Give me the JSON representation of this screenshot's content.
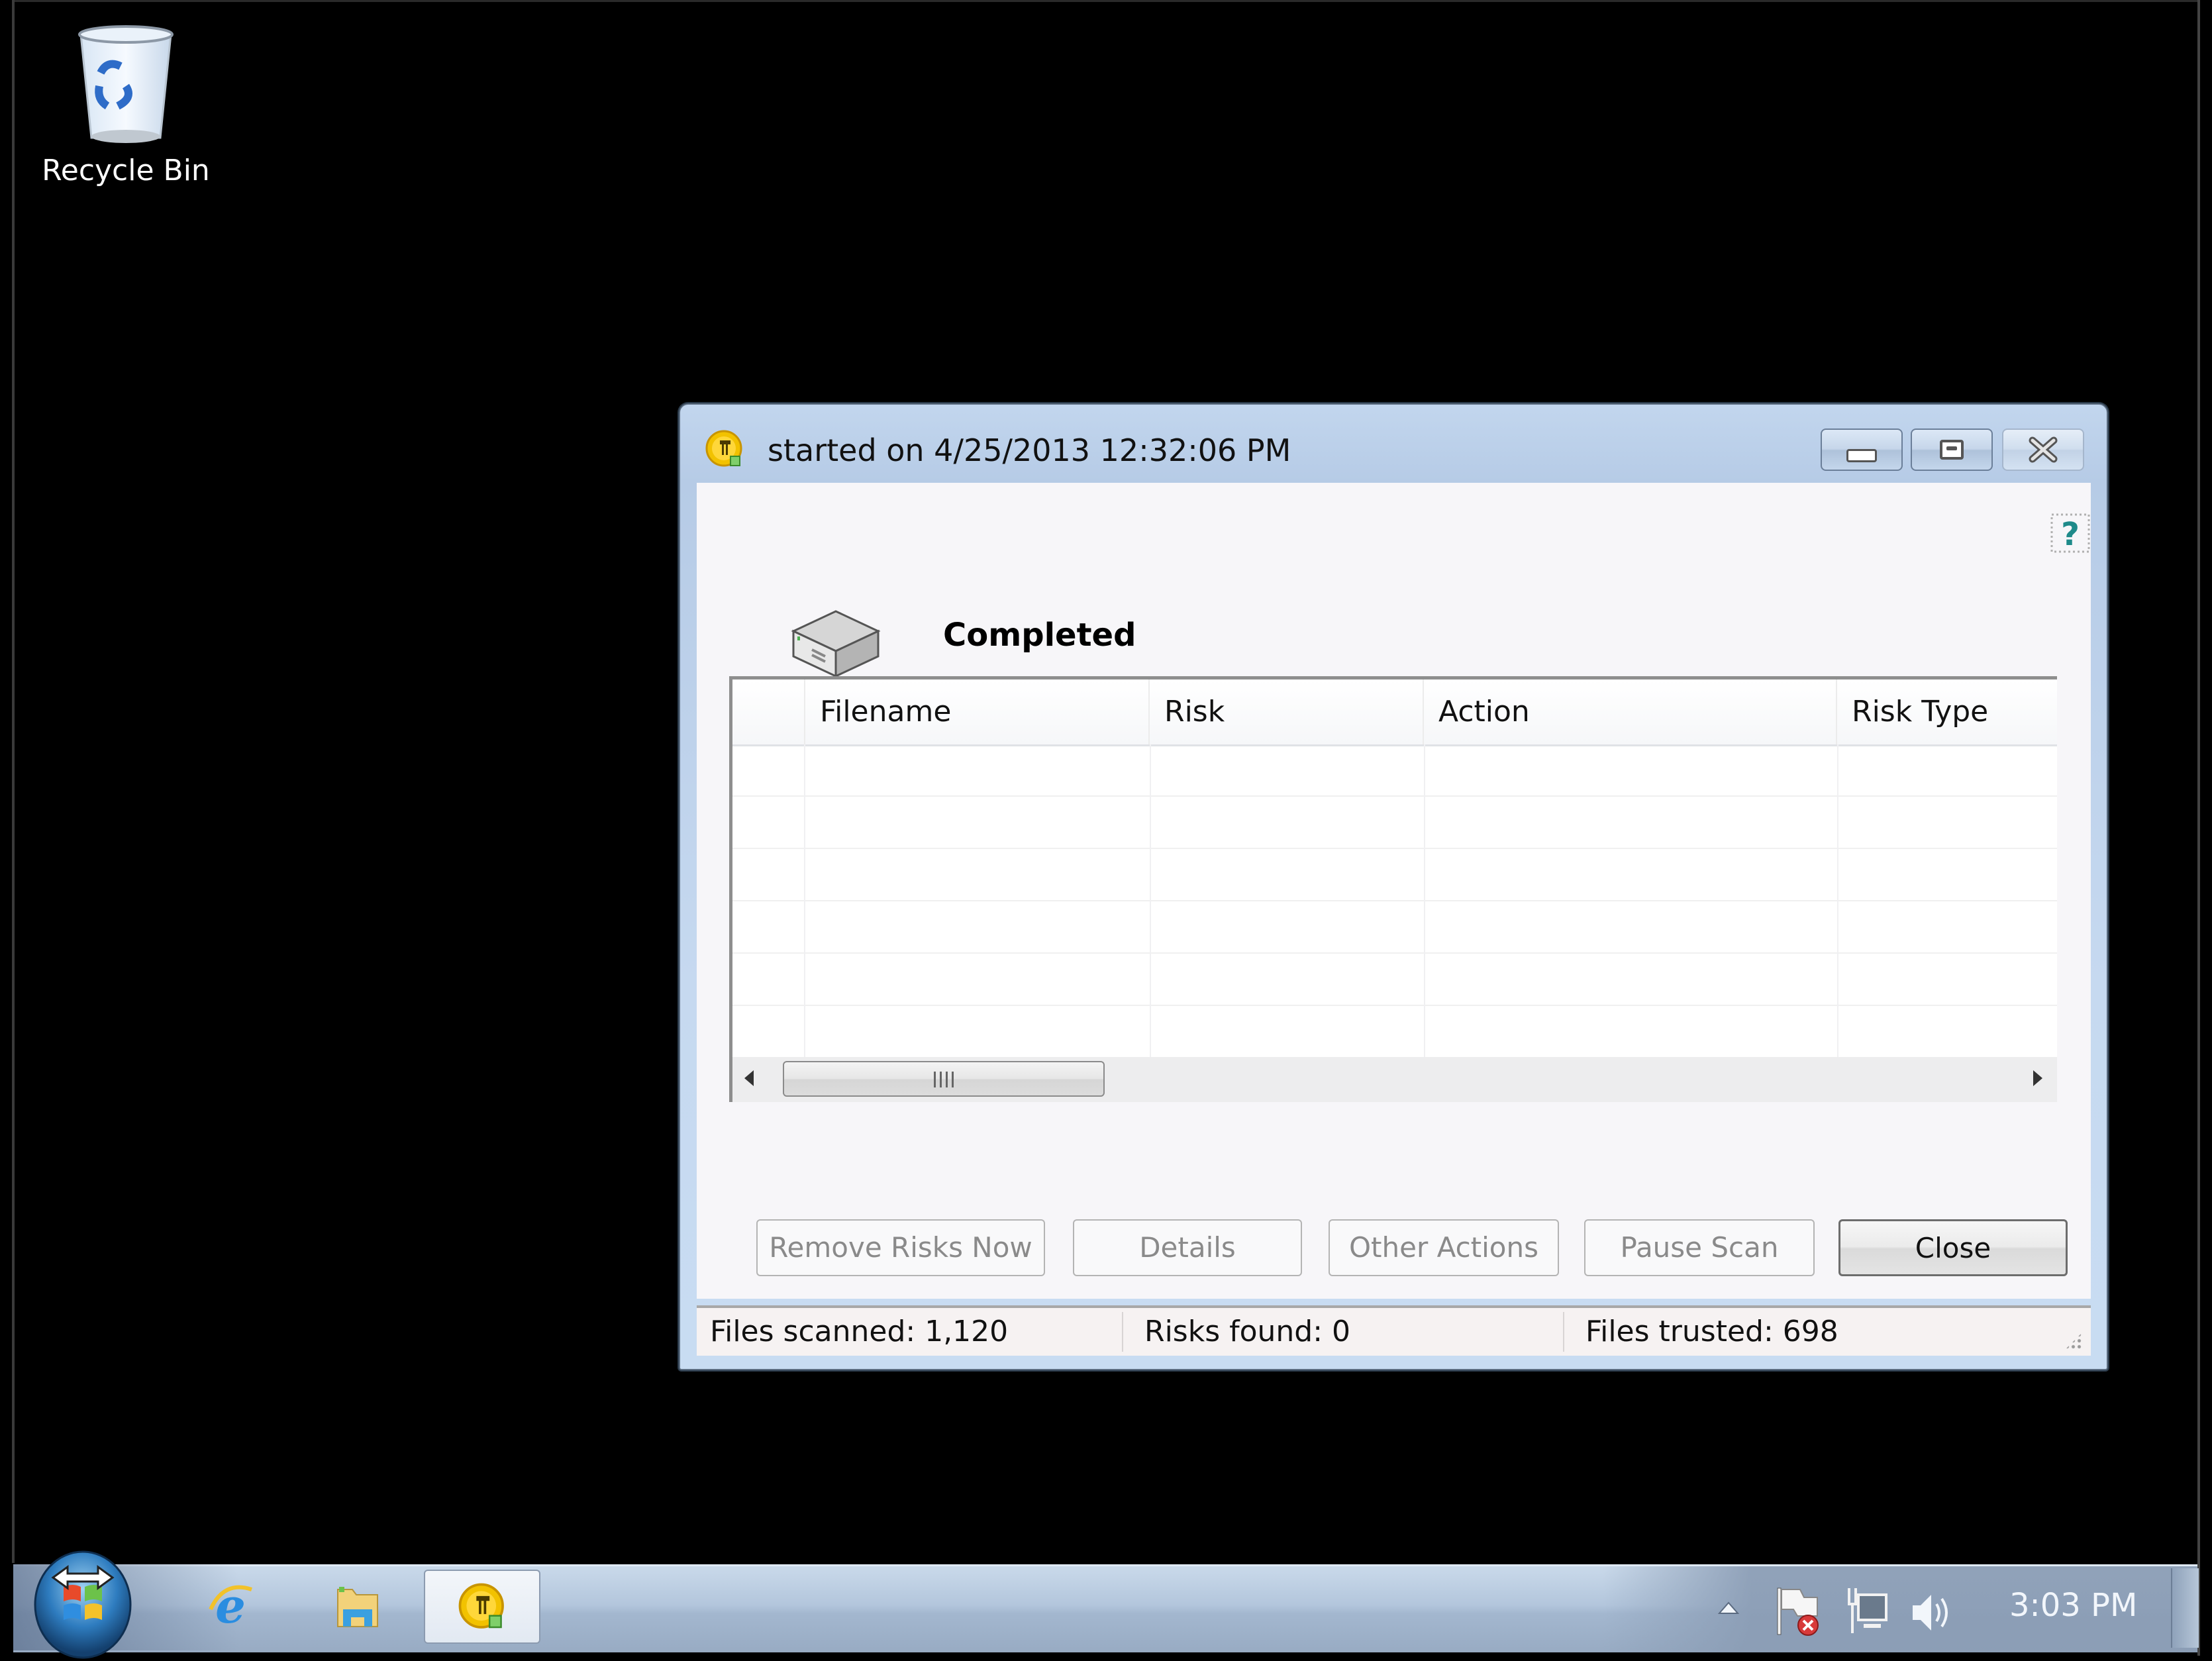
{
  "desktop": {
    "icons": [
      {
        "label": "Recycle Bin",
        "icon": "recycle-bin-icon"
      }
    ]
  },
  "window": {
    "title": "started on 4/25/2013 12:32:06 PM",
    "app_icon": "norton-shield-icon",
    "controls": {
      "minimize": "minimize",
      "maximize": "maximize",
      "close": "close"
    },
    "help_icon": "help-icon",
    "status": {
      "icon": "drive-icon",
      "title": "Completed"
    },
    "table": {
      "columns": [
        "",
        "Filename",
        "Risk",
        "Action",
        "Risk Type"
      ],
      "rows": [
        [
          "",
          "",
          "",
          "",
          ""
        ],
        [
          "",
          "",
          "",
          "",
          ""
        ],
        [
          "",
          "",
          "",
          "",
          ""
        ],
        [
          "",
          "",
          "",
          "",
          ""
        ],
        [
          "",
          "",
          "",
          "",
          ""
        ],
        [
          "",
          "",
          "",
          "",
          ""
        ]
      ],
      "scrollbar_grip": "III"
    },
    "buttons": [
      {
        "label": "Remove Risks Now",
        "enabled": false
      },
      {
        "label": "Details",
        "enabled": false
      },
      {
        "label": "Other Actions",
        "enabled": false
      },
      {
        "label": "Pause Scan",
        "enabled": false
      },
      {
        "label": "Close",
        "enabled": true
      }
    ],
    "statusbar": {
      "files_scanned": "Files scanned: 1,120",
      "risks_found": "Risks found: 0",
      "files_trusted": "Files trusted: 698"
    }
  },
  "taskbar": {
    "start": "start-button",
    "pinned": [
      {
        "name": "Internet Explorer",
        "icon": "internet-explorer-icon",
        "active": false
      },
      {
        "name": "Windows Explorer",
        "icon": "folder-icon",
        "active": false
      },
      {
        "name": "Norton",
        "icon": "norton-shield-icon",
        "active": true
      }
    ],
    "tray": {
      "icons": [
        "show-hidden-icons",
        "action-center-flag-icon",
        "network-icon",
        "volume-icon"
      ],
      "clock": "3:03 PM"
    }
  },
  "colors": {
    "window_frame": "#c2d6ee",
    "content_bg": "#f7f6f9",
    "disabled_text": "#8a8a8a",
    "taskbar": "#b3c6dc"
  }
}
